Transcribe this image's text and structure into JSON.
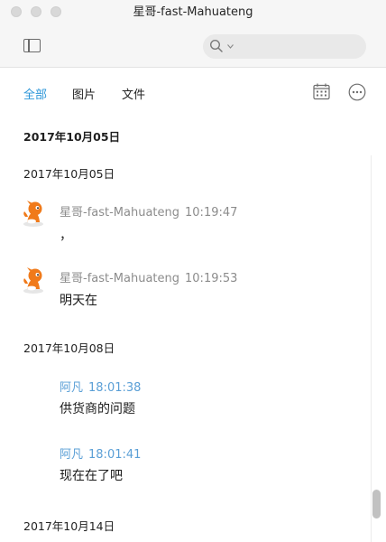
{
  "window": {
    "title": "星哥-fast-Mahuateng"
  },
  "search": {
    "placeholder": ""
  },
  "tabs": [
    {
      "label": "全部",
      "active": true
    },
    {
      "label": "图片",
      "active": false
    },
    {
      "label": "文件",
      "active": false
    }
  ],
  "sticky_date": "2017年10月05日",
  "groups": [
    {
      "date": "2017年10月05日",
      "messages": [
        {
          "sender": "星哥-fast-Mahuateng",
          "time": "10:19:47",
          "text": "，",
          "avatar": "orange-character"
        },
        {
          "sender": "星哥-fast-Mahuateng",
          "time": "10:19:53",
          "text": "明天在",
          "avatar": "orange-character"
        }
      ]
    },
    {
      "date": "2017年10月08日",
      "messages": [
        {
          "sender": "阿凡",
          "time": "18:01:38",
          "text": "供货商的问题"
        },
        {
          "sender": "阿凡",
          "time": "18:01:41",
          "text": "现在在了吧"
        }
      ]
    },
    {
      "date": "2017年10月14日",
      "messages": []
    }
  ],
  "colors": {
    "accent": "#2d97d9",
    "self_sender": "#5a9fd6",
    "other_sender": "#8c8c8c"
  },
  "icons": {
    "sidebar_toggle": "sidebar-toggle-icon",
    "search": "search-icon",
    "calendar": "calendar-icon",
    "more": "more-icon"
  }
}
